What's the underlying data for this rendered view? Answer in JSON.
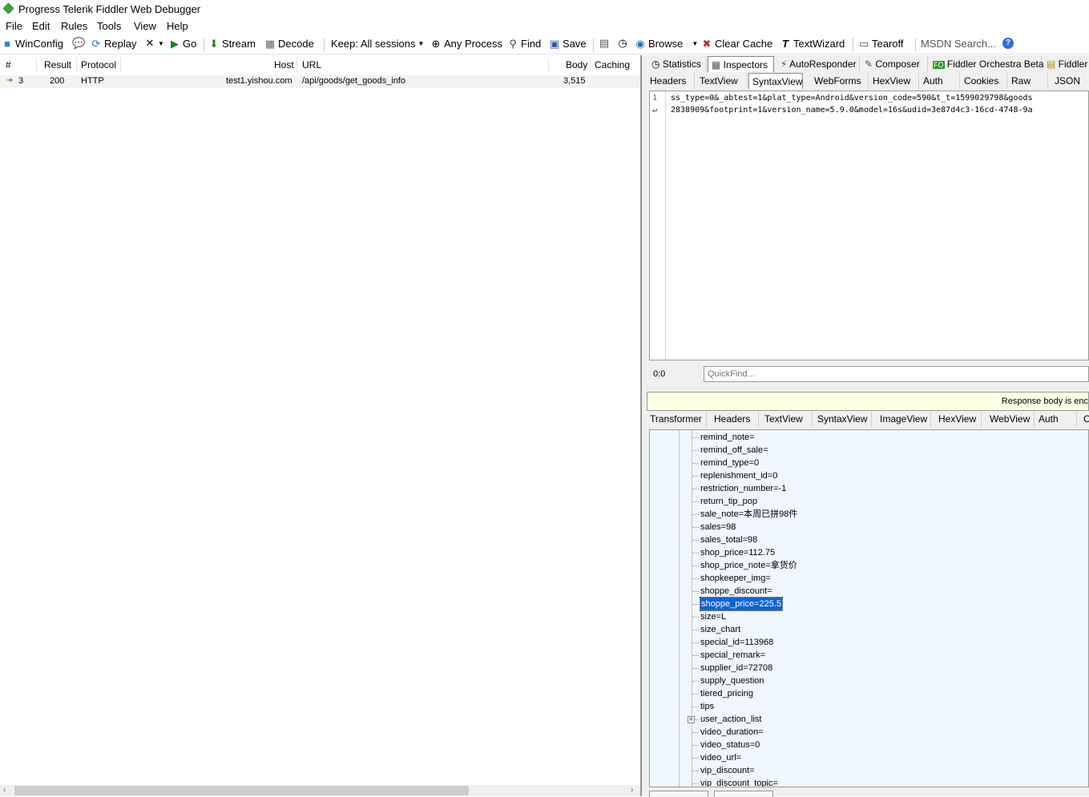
{
  "window": {
    "title": "Progress Telerik Fiddler Web Debugger"
  },
  "menu": [
    "File",
    "Edit",
    "Rules",
    "Tools",
    "View",
    "Help"
  ],
  "toolbar": {
    "winconfig": "WinConfig",
    "replay": "Replay",
    "go": "Go",
    "stream": "Stream",
    "decode": "Decode",
    "keep": "Keep: All sessions",
    "any_process": "Any Process",
    "find": "Find",
    "save": "Save",
    "browse": "Browse",
    "clear_cache": "Clear Cache",
    "textwizard": "TextWizard",
    "tearoff": "Tearoff",
    "msdn_search": "MSDN Search..."
  },
  "sessions": {
    "columns": [
      "#",
      "Result",
      "Protocol",
      "Host",
      "URL",
      "Body",
      "Caching"
    ],
    "rows": [
      {
        "id": "3",
        "result": "200",
        "protocol": "HTTP",
        "host": "test1.yishou.com",
        "url": "/api/goods/get_goods_info",
        "body": "3,515",
        "caching": ""
      }
    ]
  },
  "top_tabs": [
    "Statistics",
    "Inspectors",
    "AutoResponder",
    "Composer",
    "Fiddler Orchestra Beta",
    "Fiddler"
  ],
  "request_tabs": [
    "Headers",
    "TextView",
    "SyntaxView",
    "WebForms",
    "HexView",
    "Auth",
    "Cookies",
    "Raw",
    "JSON"
  ],
  "request_active_tab": "SyntaxView",
  "editor": {
    "line_numbers": [
      "1"
    ],
    "line1": "ss_type=0&_abtest=1&plat_type=Android&version_code=590&t_t=1599029798&goods",
    "line2": "2838909&footprint=1&version_name=5.9.0&model=16s&udid=3e87d4c3-16cd-4748-9a"
  },
  "status": {
    "position": "0:0"
  },
  "quickfind": {
    "placeholder": "QuickFind..."
  },
  "banner": {
    "text": "Response body is enc"
  },
  "response_tabs": [
    "Transformer",
    "Headers",
    "TextView",
    "SyntaxView",
    "ImageView",
    "HexView",
    "WebView",
    "Auth",
    "C"
  ],
  "tree_nodes": [
    "remind_note=",
    "remind_off_sale=",
    "remind_type=0",
    "replenishment_id=0",
    "restriction_number=-1",
    "return_tip_pop",
    "sale_note=本周已拼98件",
    "sales=98",
    "sales_total=98",
    "shop_price=112.75",
    "shop_price_note=拿货价",
    "shopkeeper_img=",
    "shoppe_discount=",
    "shoppe_price=225.5",
    "size=L",
    "size_chart",
    "special_id=113968",
    "special_remark=",
    "supplier_id=72708",
    "supply_question",
    "tiered_pricing",
    "tips",
    "user_action_list",
    "video_duration=",
    "video_status=0",
    "video_url=",
    "vip_discount=",
    "vip_discount_topic="
  ],
  "tree_selected_index": 13,
  "tree_expandable_index": 22,
  "colors": {
    "selection": "#0a64d6",
    "tree_bg": "#f0f7ff",
    "banner_bg": "#ffffe1"
  }
}
